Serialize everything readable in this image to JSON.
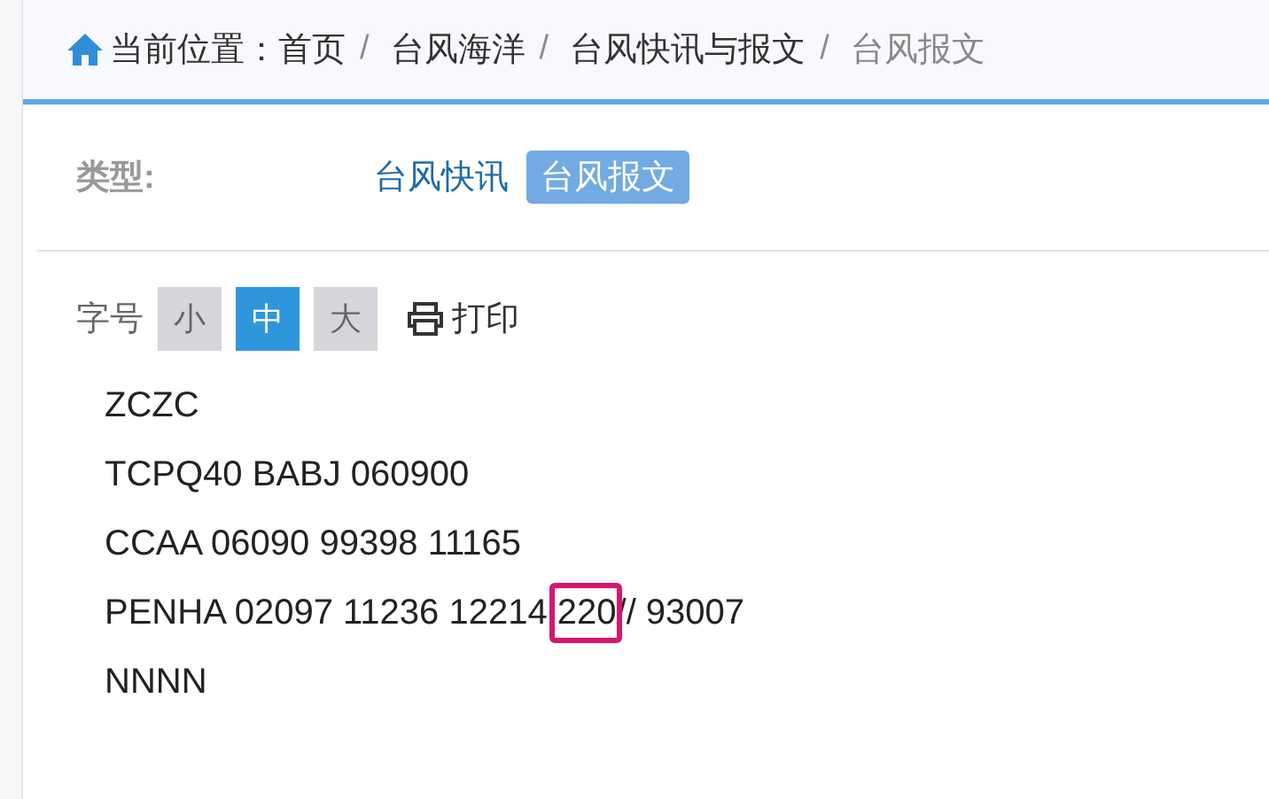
{
  "breadcrumb": {
    "label": "当前位置：",
    "items": [
      {
        "text": "首页",
        "current": false
      },
      {
        "text": "台风海洋",
        "current": false
      },
      {
        "text": "台风快讯与报文",
        "current": false
      },
      {
        "text": "台风报文",
        "current": true
      }
    ],
    "separator": "/"
  },
  "type_filter": {
    "label": "类型:",
    "options": [
      {
        "text": "台风快讯",
        "selected": false
      },
      {
        "text": "台风报文",
        "selected": true
      }
    ]
  },
  "font_size": {
    "label": "字号",
    "options": [
      {
        "text": "小",
        "selected": false
      },
      {
        "text": "中",
        "selected": true
      },
      {
        "text": "大",
        "selected": false
      }
    ]
  },
  "print": {
    "label": "打印"
  },
  "message_lines": [
    {
      "segments": [
        {
          "text": "ZCZC",
          "highlighted": false
        }
      ]
    },
    {
      "segments": [
        {
          "text": "TCPQ40 BABJ 060900",
          "highlighted": false
        }
      ]
    },
    {
      "segments": [
        {
          "text": "CCAA 06090 99398 11165",
          "highlighted": false
        }
      ]
    },
    {
      "segments": [
        {
          "text": "PENHA 02097 11236 12214 ",
          "highlighted": false
        },
        {
          "text": "220",
          "highlighted": true
        },
        {
          "text": "// 93007",
          "highlighted": false
        }
      ]
    },
    {
      "segments": [
        {
          "text": "NNNN",
          "highlighted": false
        }
      ]
    }
  ]
}
